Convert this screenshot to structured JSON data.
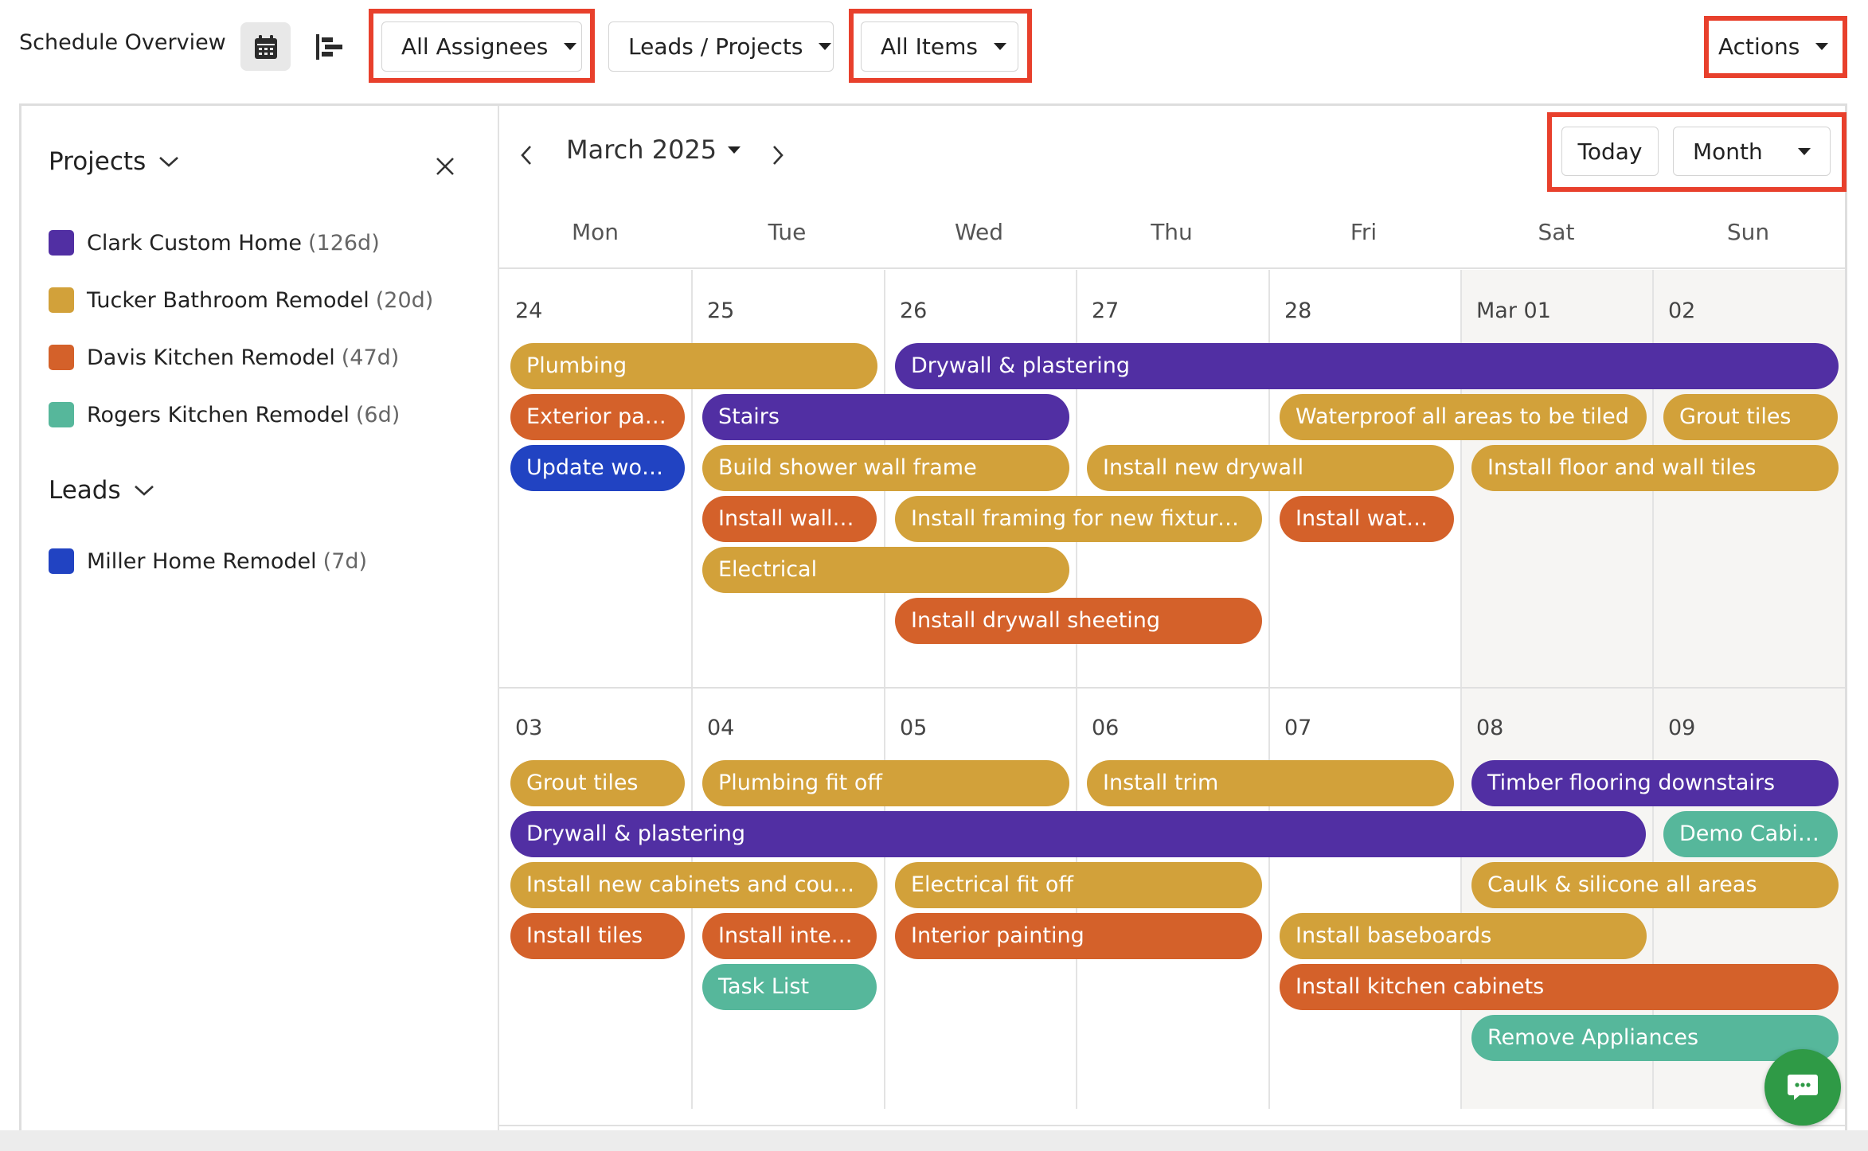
{
  "toolbar": {
    "title": "Schedule Overview",
    "calendar_view_icon": "calendar-icon",
    "gantt_view_icon": "gantt-icon",
    "assignees_filter": "All Assignees",
    "type_filter": "Leads / Projects",
    "items_filter": "All Items",
    "actions": "Actions"
  },
  "sidebar": {
    "projects_heading": "Projects",
    "leads_heading": "Leads",
    "projects": [
      {
        "name": "Clark Custom Home",
        "duration": "(126d)",
        "color": "#512fa3"
      },
      {
        "name": "Tucker Bathroom Remodel",
        "duration": "(20d)",
        "color": "#d2a13a"
      },
      {
        "name": "Davis Kitchen Remodel",
        "duration": "(47d)",
        "color": "#d4612a"
      },
      {
        "name": "Rogers Kitchen Remodel",
        "duration": "(6d)",
        "color": "#56b79b"
      }
    ],
    "leads": [
      {
        "name": "Miller Home Remodel",
        "duration": "(7d)",
        "color": "#2143c2"
      }
    ]
  },
  "calendar": {
    "month_label": "March 2025",
    "today_label": "Today",
    "view_label": "Month",
    "weekdays": [
      "Mon",
      "Tue",
      "Wed",
      "Thu",
      "Fri",
      "Sat",
      "Sun"
    ],
    "weeks": [
      {
        "days": [
          "24",
          "25",
          "26",
          "27",
          "28",
          "Mar 01",
          "02"
        ],
        "events": [
          {
            "title": "Plumbing",
            "start": 0,
            "span": 2,
            "row": 0,
            "color": "gold"
          },
          {
            "title": "Drywall & plastering",
            "start": 2,
            "span": 5,
            "row": 0,
            "color": "purple"
          },
          {
            "title": "Exterior painting",
            "start": 0,
            "span": 1,
            "row": 1,
            "color": "orange"
          },
          {
            "title": "Stairs",
            "start": 1,
            "span": 2,
            "row": 1,
            "color": "purple"
          },
          {
            "title": "Waterproof all areas to be tiled",
            "start": 4,
            "span": 2,
            "row": 1,
            "color": "gold"
          },
          {
            "title": "Grout tiles",
            "start": 6,
            "span": 1,
            "row": 1,
            "color": "gold"
          },
          {
            "title": "Update work order",
            "start": 0,
            "span": 1,
            "row": 2,
            "color": "blue"
          },
          {
            "title": "Build shower wall frame",
            "start": 1,
            "span": 2,
            "row": 2,
            "color": "gold"
          },
          {
            "title": "Install new drywall",
            "start": 3,
            "span": 2,
            "row": 2,
            "color": "gold"
          },
          {
            "title": "Install floor and wall tiles",
            "start": 5,
            "span": 2,
            "row": 2,
            "color": "gold"
          },
          {
            "title": "Install wall and floor tiles",
            "start": 1,
            "span": 1,
            "row": 3,
            "color": "orange"
          },
          {
            "title": "Install framing for new fixtures and layout",
            "start": 2,
            "span": 2,
            "row": 3,
            "color": "gold"
          },
          {
            "title": "Install waterproofing",
            "start": 4,
            "span": 1,
            "row": 3,
            "color": "orange"
          },
          {
            "title": "Electrical",
            "start": 1,
            "span": 2,
            "row": 4,
            "color": "gold"
          },
          {
            "title": "Install drywall sheeting",
            "start": 2,
            "span": 2,
            "row": 5,
            "color": "orange"
          }
        ]
      },
      {
        "days": [
          "03",
          "04",
          "05",
          "06",
          "07",
          "08",
          "09"
        ],
        "events": [
          {
            "title": "Grout tiles",
            "start": 0,
            "span": 1,
            "row": 0,
            "color": "gold"
          },
          {
            "title": "Plumbing fit off",
            "start": 1,
            "span": 2,
            "row": 0,
            "color": "gold"
          },
          {
            "title": "Install trim",
            "start": 3,
            "span": 2,
            "row": 0,
            "color": "gold"
          },
          {
            "title": "Timber flooring downstairs",
            "start": 5,
            "span": 2,
            "row": 0,
            "color": "purple"
          },
          {
            "title": "Drywall & plastering",
            "start": 0,
            "span": 6,
            "row": 1,
            "color": "purple"
          },
          {
            "title": "Demo Cabinets",
            "start": 6,
            "span": 1,
            "row": 1,
            "color": "teal"
          },
          {
            "title": "Install new cabinets and countertops",
            "start": 0,
            "span": 2,
            "row": 2,
            "color": "gold"
          },
          {
            "title": "Electrical fit off",
            "start": 2,
            "span": 2,
            "row": 2,
            "color": "gold"
          },
          {
            "title": "Caulk & silicone all areas",
            "start": 5,
            "span": 2,
            "row": 2,
            "color": "gold"
          },
          {
            "title": "Install tiles",
            "start": 0,
            "span": 1,
            "row": 3,
            "color": "orange"
          },
          {
            "title": "Install interior doors",
            "start": 1,
            "span": 1,
            "row": 3,
            "color": "orange"
          },
          {
            "title": "Interior painting",
            "start": 2,
            "span": 2,
            "row": 3,
            "color": "orange"
          },
          {
            "title": "Install baseboards",
            "start": 4,
            "span": 2,
            "row": 3,
            "color": "gold"
          },
          {
            "title": "Task List",
            "start": 1,
            "span": 1,
            "row": 4,
            "color": "teal"
          },
          {
            "title": "Install kitchen cabinets",
            "start": 4,
            "span": 3,
            "row": 4,
            "color": "orange"
          },
          {
            "title": "Remove Appliances",
            "start": 5,
            "span": 2,
            "row": 5,
            "color": "teal"
          }
        ]
      }
    ]
  },
  "highlight_color": "#e8402c",
  "chat_icon": "chat-icon"
}
